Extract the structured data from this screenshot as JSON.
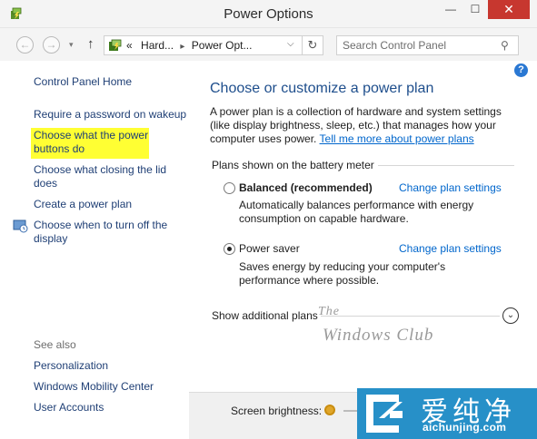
{
  "window": {
    "title": "Power Options",
    "minimize_glyph": "—",
    "maximize_glyph": "☐",
    "close_glyph": "✕"
  },
  "nav": {
    "back_glyph": "←",
    "forward_glyph": "→",
    "recent_glyph": "▾",
    "up_glyph": "↑",
    "breadcrumb": {
      "overflow": "«",
      "items": [
        "Hard...",
        "Power Opt..."
      ],
      "separator": "▸",
      "dropdown_glyph": "⌵"
    },
    "refresh_glyph": "↻",
    "search_placeholder": "Search Control Panel",
    "search_glyph": "⚲"
  },
  "help_glyph": "?",
  "sidebar": {
    "home": "Control Panel Home",
    "links": [
      "Require a password on wakeup",
      "Choose what the power buttons do",
      "Choose what closing the lid does",
      "Create a power plan",
      "Choose when to turn off the display"
    ],
    "see_also_label": "See also",
    "see_also": [
      "Personalization",
      "Windows Mobility Center",
      "User Accounts"
    ]
  },
  "main": {
    "title": "Choose or customize a power plan",
    "intro": "A power plan is a collection of hardware and system settings (like display brightness, sleep, etc.) that manages how your computer uses power.",
    "intro_link": "Tell me more about power plans",
    "group_label": "Plans shown on the battery meter",
    "plans": [
      {
        "name": "Balanced (recommended)",
        "selected": false,
        "link": "Change plan settings",
        "description": "Automatically balances performance with energy consumption on capable hardware."
      },
      {
        "name": "Power saver",
        "selected": true,
        "link": "Change plan settings",
        "description": "Saves energy by reducing your computer's performance where possible."
      }
    ],
    "show_additional": "Show additional plans",
    "expand_glyph": "⌄"
  },
  "watermark": {
    "line1": "The",
    "line2": "Windows Club"
  },
  "bottom": {
    "brightness_label": "Screen brightness:"
  },
  "logo": {
    "chinese_text": "爱纯净",
    "url": "aichunjing.com"
  }
}
